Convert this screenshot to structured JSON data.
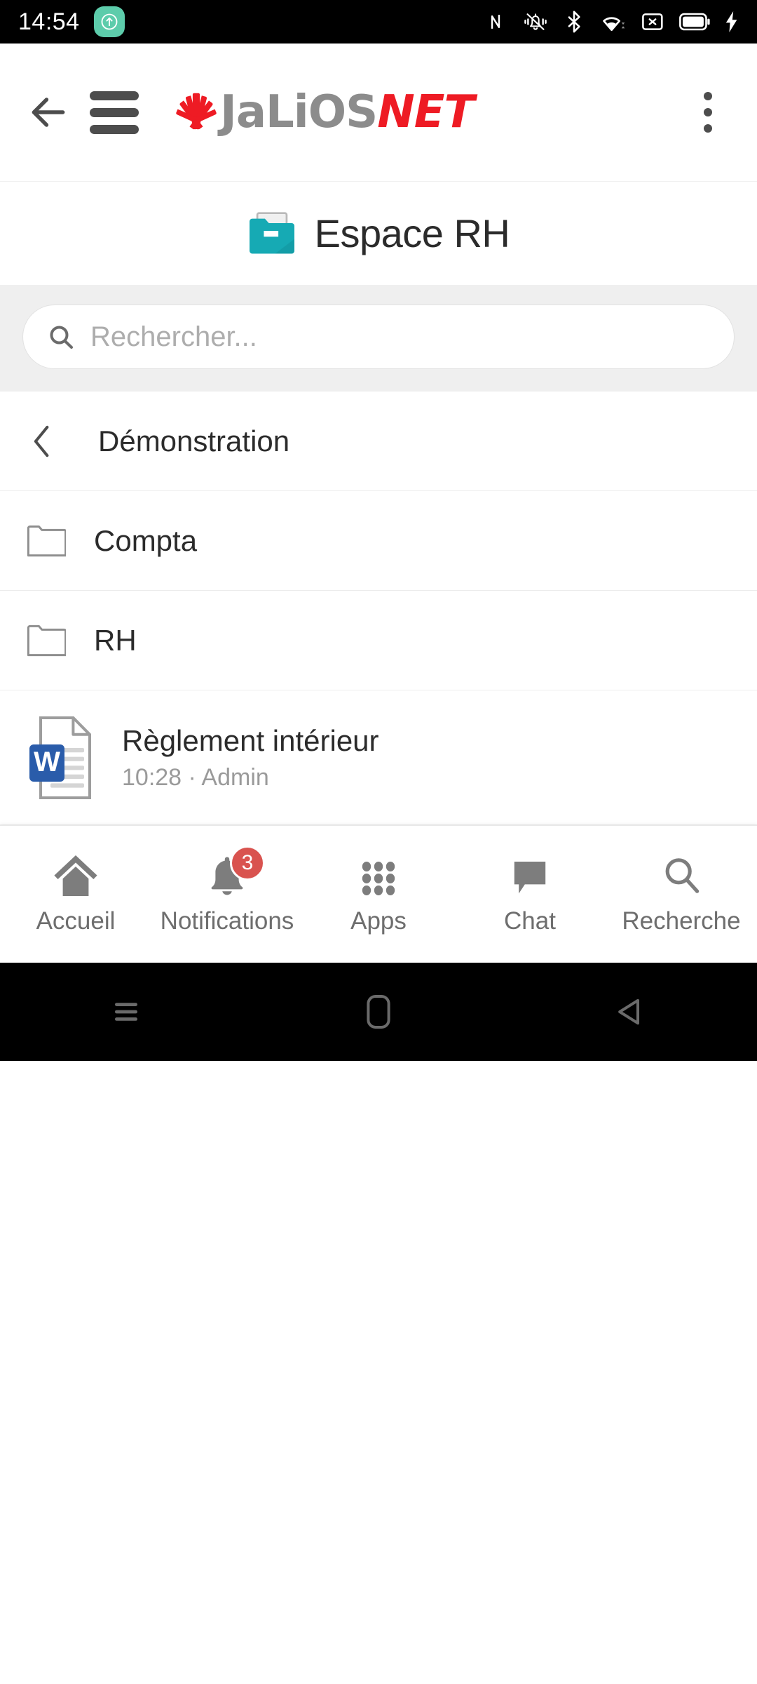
{
  "statusbar": {
    "time": "14:54",
    "left_icons": [
      {
        "name": "upload-circle-icon",
        "color": "#5dccab"
      }
    ],
    "right_icons": [
      {
        "name": "nfc-icon"
      },
      {
        "name": "vibrate-mute-bell-icon"
      },
      {
        "name": "bluetooth-icon"
      },
      {
        "name": "wifi-icon"
      },
      {
        "name": "no-sim-card-icon"
      },
      {
        "name": "battery-full-icon"
      },
      {
        "name": "charging-bolt-icon"
      }
    ]
  },
  "appbar": {
    "back_icon": "back-arrow-icon",
    "menu_icon": "hamburger-menu-icon",
    "overflow_icon": "kebab-menu-icon",
    "brand": {
      "mark": "jalios-shell-logo",
      "name_primary": "JaLiOS",
      "name_secondary": "NET",
      "color_primary": "#8c8c8c",
      "color_secondary": "#ee1b24"
    }
  },
  "page": {
    "icon": "teal-folder-icon",
    "icon_color": "#16aab4",
    "title": "Espace RH"
  },
  "search": {
    "icon": "search-icon",
    "value": "",
    "placeholder": "Rechercher..."
  },
  "list": {
    "parent": {
      "icon": "chevron-left-icon",
      "label": "Démonstration"
    },
    "items": [
      {
        "type": "folder",
        "icon": "folder-outline-icon",
        "label": "Compta"
      },
      {
        "type": "folder",
        "icon": "folder-outline-icon",
        "label": "RH"
      },
      {
        "type": "file",
        "icon": "word-document-icon",
        "label": "Règlement intérieur",
        "meta": "10:28 · Admin"
      }
    ]
  },
  "bottomnav": {
    "items": [
      {
        "icon": "home-icon",
        "label": "Accueil"
      },
      {
        "icon": "bell-icon",
        "label": "Notifications",
        "badge": "3"
      },
      {
        "icon": "apps-grid-icon",
        "label": "Apps"
      },
      {
        "icon": "chat-bubble-icon",
        "label": "Chat"
      },
      {
        "icon": "search-icon",
        "label": "Recherche"
      }
    ],
    "badge_color": "#d9534f",
    "label_color": "#6e6e6e"
  },
  "androidnav": {
    "items": [
      {
        "icon": "recents-menu-icon"
      },
      {
        "icon": "home-pill-icon"
      },
      {
        "icon": "back-triangle-icon"
      }
    ]
  }
}
